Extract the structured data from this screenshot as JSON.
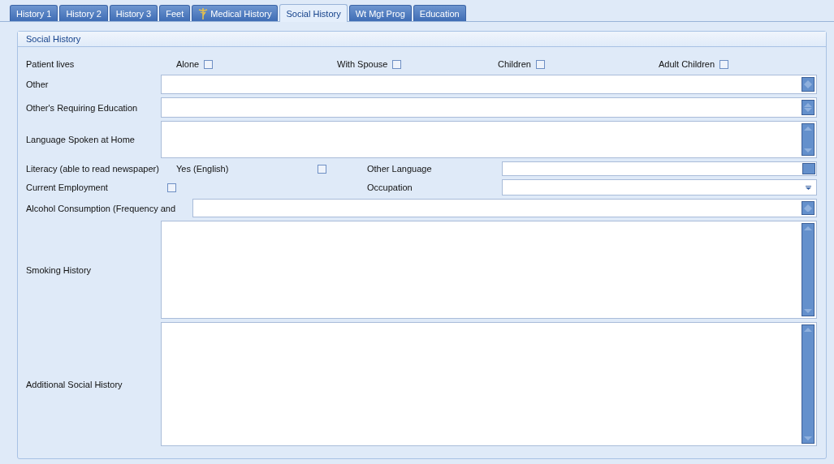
{
  "tabs": [
    {
      "label": "History 1",
      "selected": false,
      "kind": "text"
    },
    {
      "label": "History 2",
      "selected": false,
      "kind": "text"
    },
    {
      "label": "History 3",
      "selected": false,
      "kind": "text"
    },
    {
      "label": "Feet",
      "selected": false,
      "kind": "text"
    },
    {
      "label": "Medical History",
      "selected": false,
      "kind": "icon"
    },
    {
      "label": "Social History",
      "selected": true,
      "kind": "text"
    },
    {
      "label": "Wt Mgt Prog",
      "selected": false,
      "kind": "text"
    },
    {
      "label": "Education",
      "selected": false,
      "kind": "text"
    }
  ],
  "group": {
    "title": "Social History"
  },
  "patient_lives": {
    "label": "Patient lives",
    "options": [
      {
        "label": "Alone",
        "checked": false
      },
      {
        "label": "With Spouse",
        "checked": false
      },
      {
        "label": "Children",
        "checked": false
      },
      {
        "label": "Adult Children",
        "checked": false
      }
    ]
  },
  "other": {
    "label": "Other"
  },
  "others_requiring_education": {
    "label": "Other's Requiring Education"
  },
  "language_spoken": {
    "label": "Language Spoken at Home"
  },
  "literacy": {
    "label": "Literacy (able to read newspaper)",
    "option": "Yes (English)",
    "checked": false
  },
  "other_language": {
    "label": "Other Language"
  },
  "current_employment": {
    "label": "Current Employment",
    "checked": false
  },
  "occupation": {
    "label": "Occupation"
  },
  "alcohol": {
    "label": "Alcohol Consumption (Frequency and"
  },
  "smoking": {
    "label": "Smoking History"
  },
  "additional": {
    "label": "Additional Social History"
  }
}
